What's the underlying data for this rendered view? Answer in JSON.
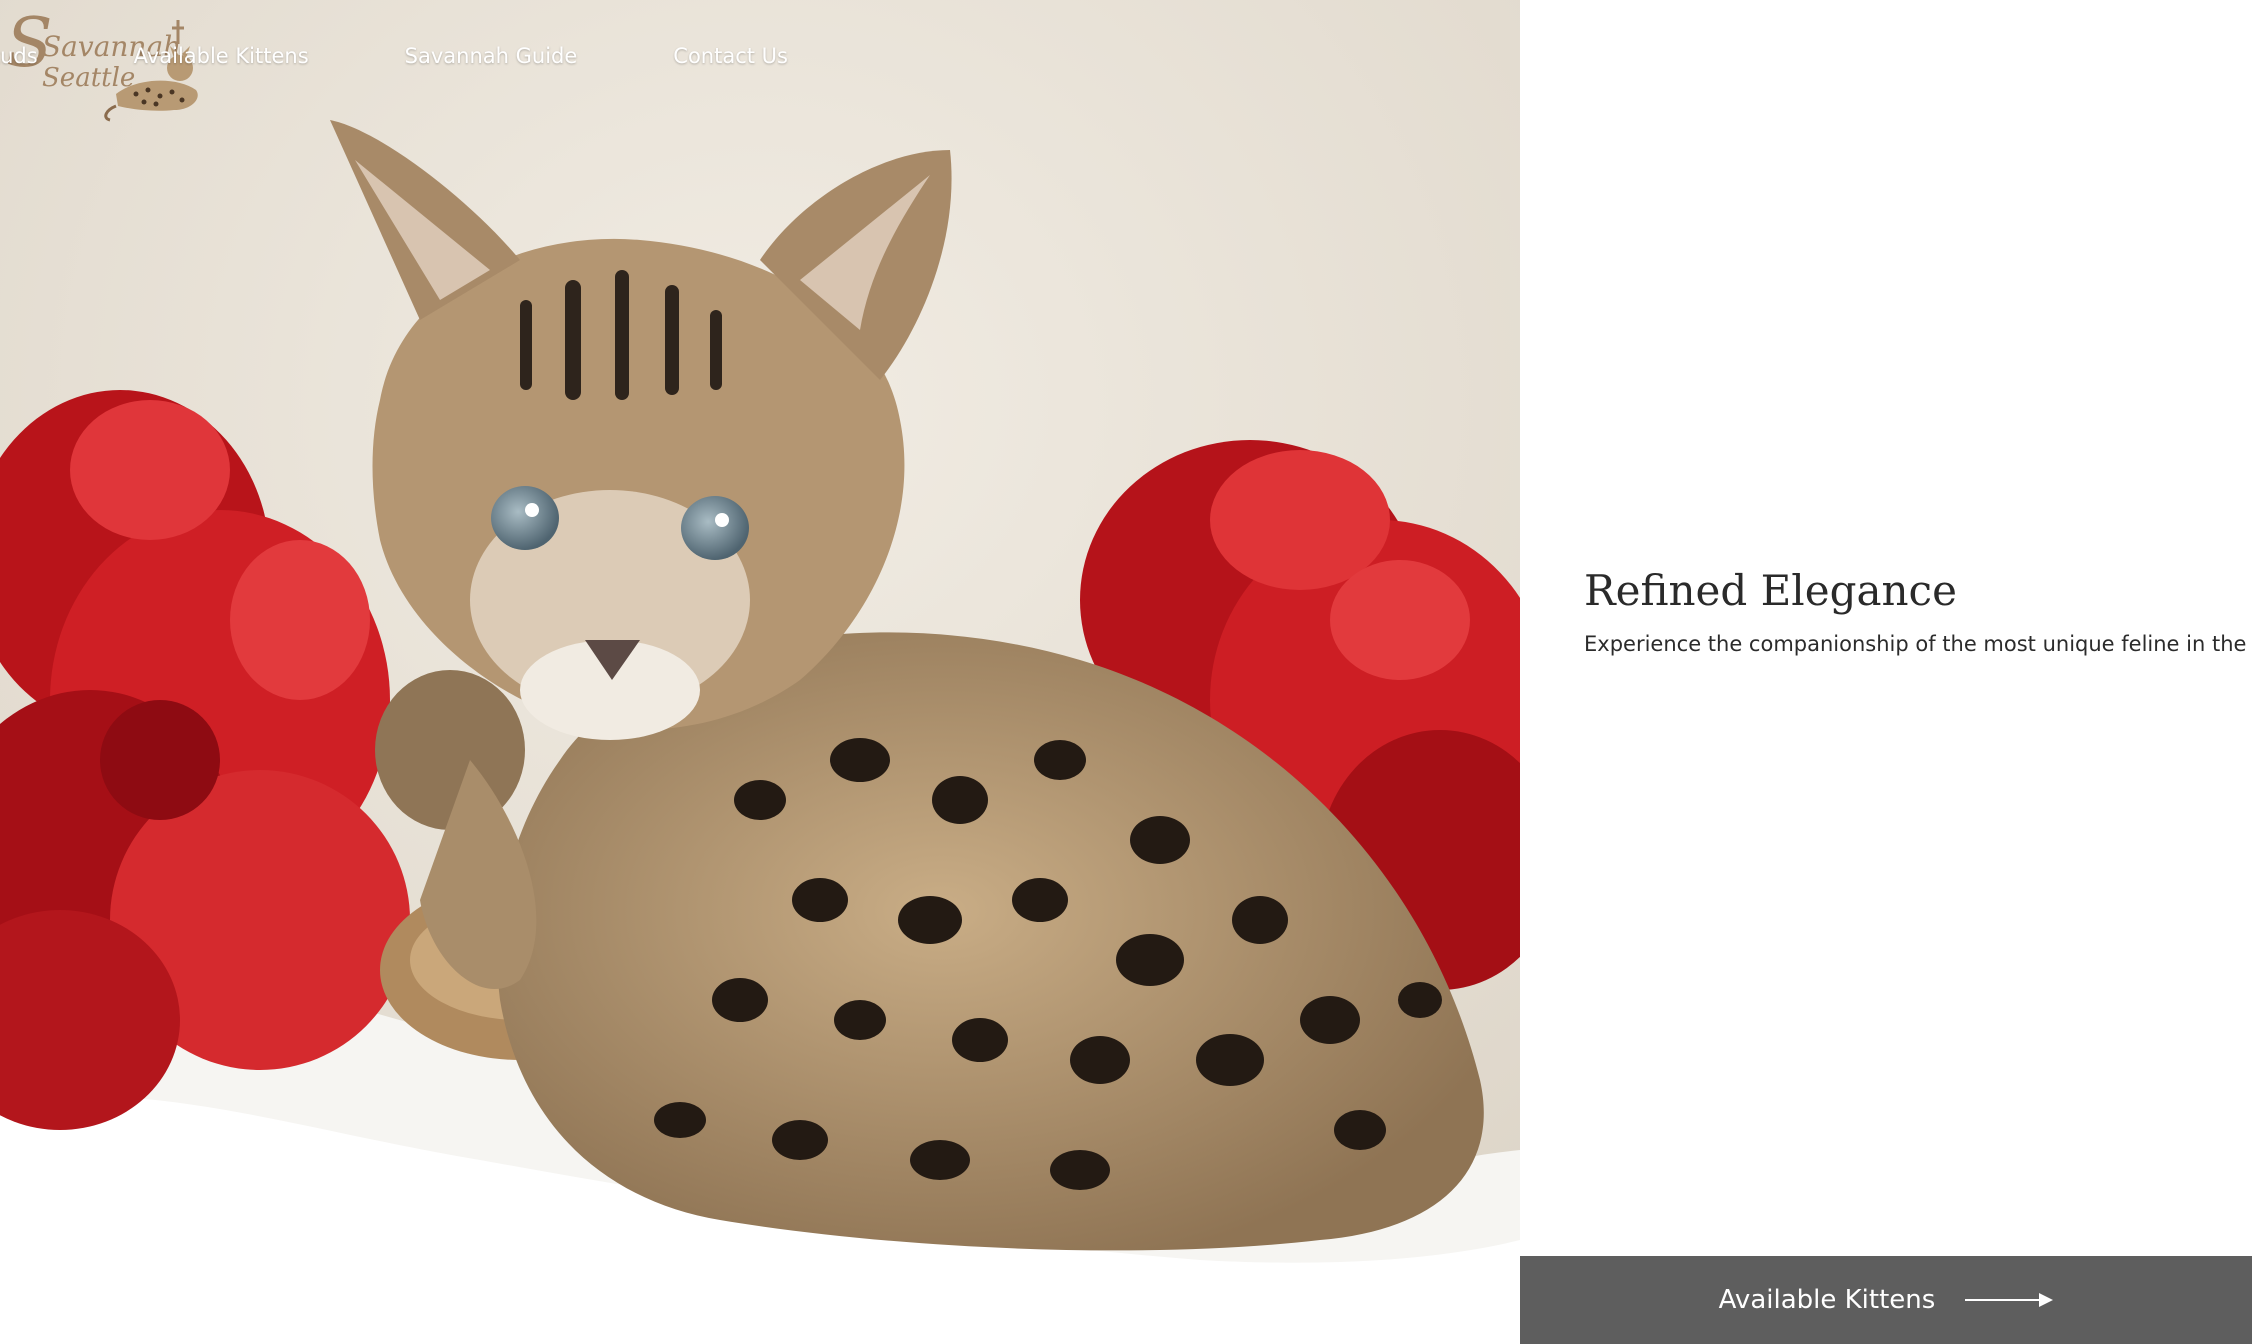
{
  "brand": {
    "logo_text": [
      "Savannah",
      "Seattle"
    ],
    "logo_icon": "spotted-cat-with-crown-icon",
    "accent": "#a48666"
  },
  "nav": {
    "items": [
      {
        "label": "Queens & Studs"
      },
      {
        "label": "Available Kittens"
      },
      {
        "label": "Savannah Guide"
      },
      {
        "label": "Contact Us"
      }
    ]
  },
  "hero": {
    "image": "savannah-kitten-photo",
    "colors": {
      "fur_bg": "#ece7dd",
      "flowers": "#c8141b"
    }
  },
  "panel": {
    "title": "Refined Elegance",
    "subtitle": "Experience the companionship of the most unique feline in the world",
    "cta": {
      "label": "Available Kittens",
      "icon": "arrow-right-icon",
      "bg": "#5e5e5e"
    }
  }
}
